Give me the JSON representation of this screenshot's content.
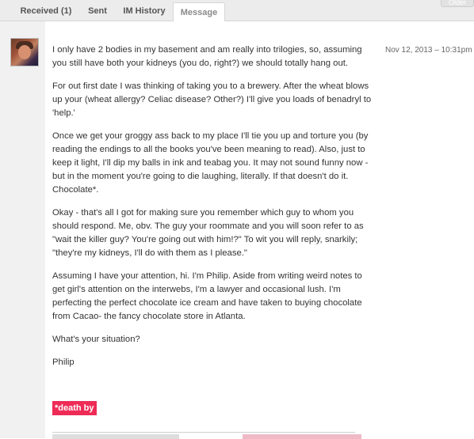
{
  "tabs": [
    {
      "label": "Received (1)"
    },
    {
      "label": "Sent"
    },
    {
      "label": "IM History"
    },
    {
      "label": "Message"
    }
  ],
  "older_button": {
    "label": "Older"
  },
  "message": {
    "date": "Nov 12, 2013 – 10:31pm",
    "paragraphs": [
      "I only have 2 bodies in my basement and am really into trilogies, so, assuming\nyou still have both your kidneys (you do, right?) we should totally hang out.",
      "For out first date I was thinking of taking you to a brewery. After the wheat blows\nup your (wheat allergy? Celiac disease? Other?) I'll give you loads of benadryl to\n'help.'",
      "Once we get your groggy ass back to my place I'll tie you up and torture you (by\nreading the endings to all the books you've been meaning to read). Also, just to\nkeep it light, I'll dip my balls in ink and teabag you. It may not sound funny now -\nbut in the moment you're going to die laughing, literally. If that doesn't do it.\nChocolate*.",
      "Okay - that's all I got for making sure you remember which guy to whom you\nshould respond. Me, obv. The guy your roommate and you will soon refer to as\n\"wait the killer guy? You're going out with him!?\" To wit you will reply, snarkily;\n\"they're my kidneys, I'll do with them as I please.\"",
      "Assuming I have your attention, hi. I'm Philip. Aside from writing weird notes to\nget girl's attention on the interwebs, I'm a lawyer and occasional lush. I'm\nperfecting the perfect chocolate ice cream and have taken to buying chocolate\nfrom Cacao- the fancy chocolate store in Atlanta.",
      "What's your situation?",
      "Philip"
    ],
    "footnote": "*death by"
  },
  "colors": {
    "highlight": "#ee2b56",
    "tabbar": "#ececec"
  }
}
